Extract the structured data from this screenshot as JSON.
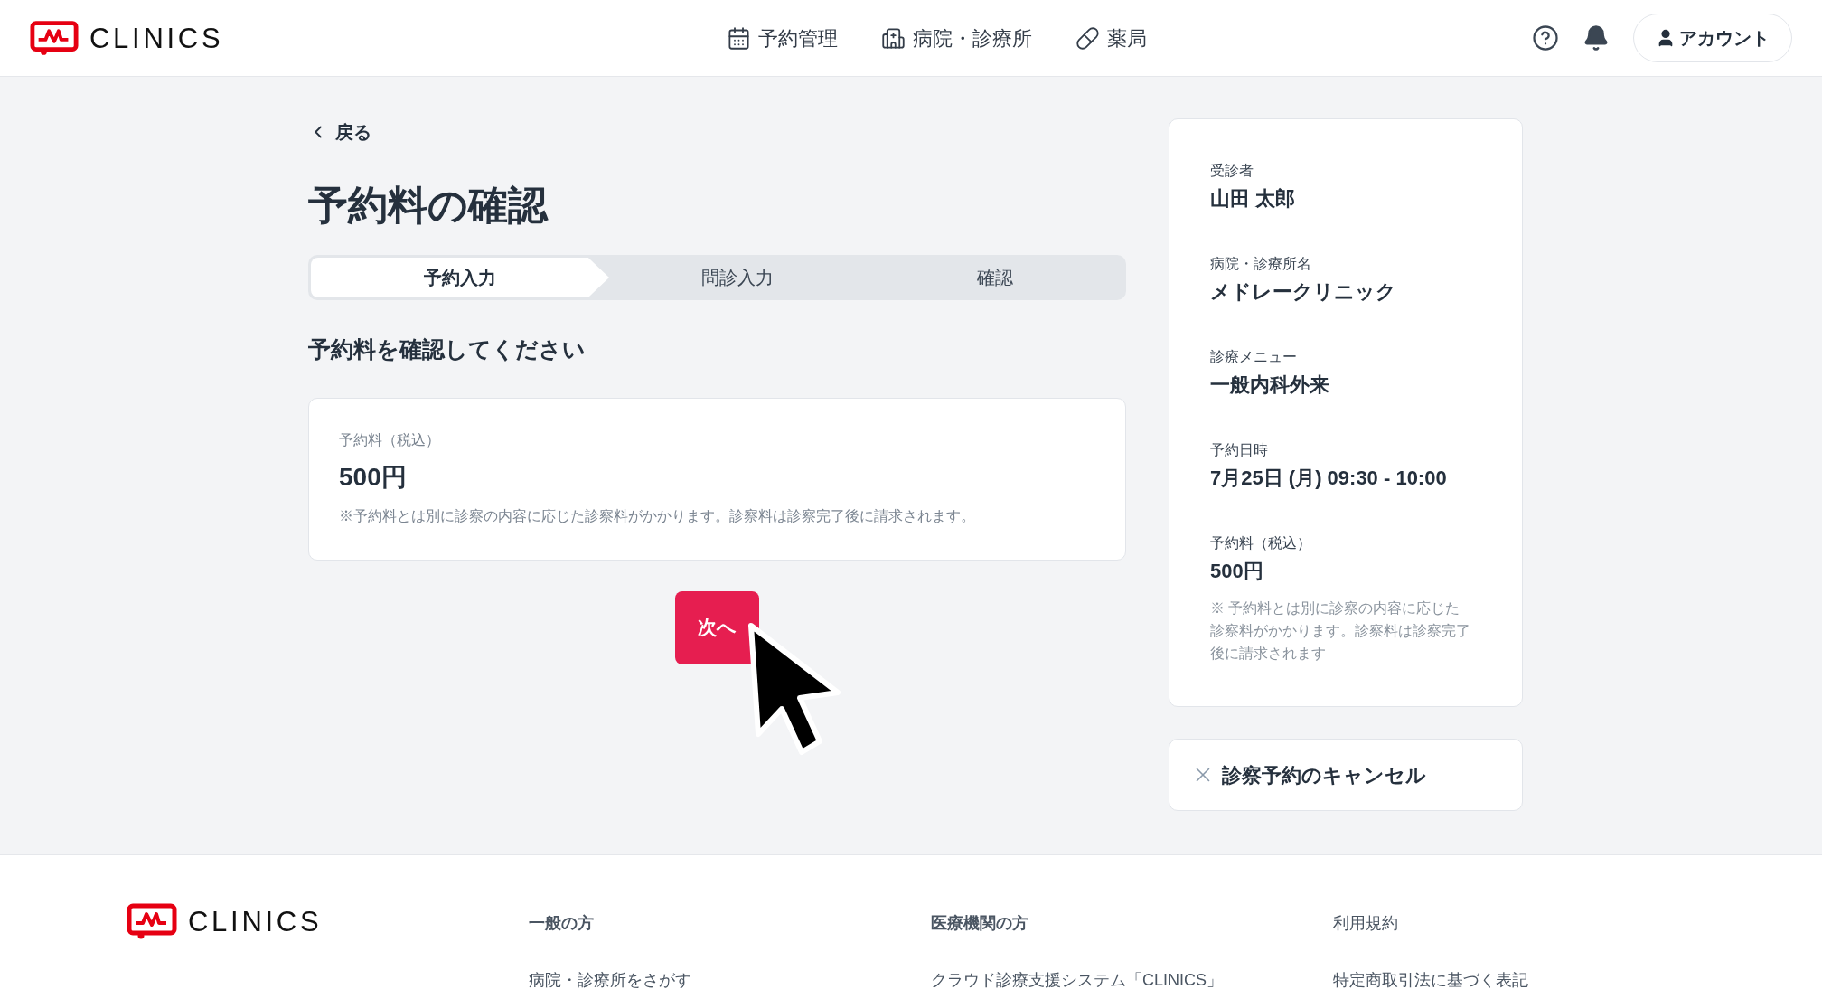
{
  "header": {
    "logo": "CLINICS",
    "nav": [
      {
        "kind": "calendar",
        "label": "予約管理"
      },
      {
        "kind": "hospital",
        "label": "病院・診療所"
      },
      {
        "kind": "pill",
        "label": "薬局"
      }
    ],
    "account": "アカウント"
  },
  "back": "戻る",
  "title": "予約料の確認",
  "steps": [
    {
      "label": "予約入力",
      "selected": true
    },
    {
      "label": "問診入力",
      "selected": false
    },
    {
      "label": "確認",
      "selected": false
    }
  ],
  "subheading": "予約料を確認してください",
  "fee_card": {
    "label": "予約料（税込）",
    "amount": "500円",
    "note": "※予約料とは別に診察の内容に応じた診察料がかかります。診察料は診察完了後に請求されます。"
  },
  "next_button": "次へ",
  "summary": [
    {
      "label": "受診者",
      "value": "山田 太郎"
    },
    {
      "label": "病院・診療所名",
      "value": "メドレークリニック"
    },
    {
      "label": "診療メニュー",
      "value": "一般内科外来"
    },
    {
      "label": "予約日時",
      "value": "7月25日 (月) 09:30 - 10:00"
    },
    {
      "label": "予約料（税込）",
      "value": "500円",
      "note": "※ 予約料とは別に診察の内容に応じた診察料がかかります。診察料は診察完了後に請求されます"
    }
  ],
  "cancel": "診察予約のキャンセル",
  "footer": {
    "logo": "CLINICS",
    "columns": [
      {
        "heading": "一般の方",
        "links": [
          "病院・診療所をさがす"
        ]
      },
      {
        "heading": "医療機関の方",
        "links": [
          "クラウド診療支援システム「CLINICS」"
        ]
      },
      {
        "links": [
          "利用規約",
          "特定商取引法に基づく表記"
        ]
      }
    ]
  }
}
